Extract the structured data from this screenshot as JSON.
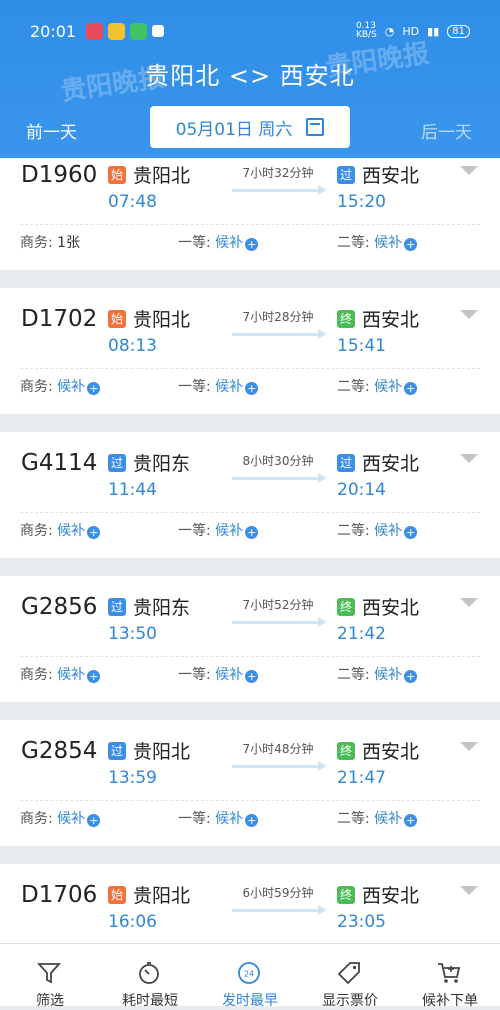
{
  "status_bar": {
    "time": "20:01",
    "network_speed": "0.13\nKB/S",
    "hd_label": "HD",
    "battery": "81"
  },
  "header": {
    "title": "贵阳北 <> 西安北",
    "prev_day": "前一天",
    "next_day": "后一天",
    "date": "05月01日 周六"
  },
  "watermark": "贵阳晚报",
  "trains": [
    {
      "no": "D1960",
      "from_badge": "始",
      "from_badge_type": "start",
      "from": "贵阳北",
      "dep": "07:48",
      "duration": "7小时32分钟",
      "to_badge": "过",
      "to_badge_type": "pass",
      "to": "西安北",
      "arr": "15:20",
      "seats": [
        {
          "label": "商务:",
          "value": "1张",
          "plus": false
        },
        {
          "label": "一等:",
          "value": "候补",
          "plus": true
        },
        {
          "label": "二等:",
          "value": "候补",
          "plus": true
        }
      ]
    },
    {
      "no": "D1702",
      "from_badge": "始",
      "from_badge_type": "start",
      "from": "贵阳北",
      "dep": "08:13",
      "duration": "7小时28分钟",
      "to_badge": "终",
      "to_badge_type": "end",
      "to": "西安北",
      "arr": "15:41",
      "seats": [
        {
          "label": "商务:",
          "value": "候补",
          "plus": true
        },
        {
          "label": "一等:",
          "value": "候补",
          "plus": true
        },
        {
          "label": "二等:",
          "value": "候补",
          "plus": true
        }
      ]
    },
    {
      "no": "G4114",
      "from_badge": "过",
      "from_badge_type": "pass",
      "from": "贵阳东",
      "dep": "11:44",
      "duration": "8小时30分钟",
      "to_badge": "过",
      "to_badge_type": "pass",
      "to": "西安北",
      "arr": "20:14",
      "seats": [
        {
          "label": "商务:",
          "value": "候补",
          "plus": true
        },
        {
          "label": "一等:",
          "value": "候补",
          "plus": true
        },
        {
          "label": "二等:",
          "value": "候补",
          "plus": true
        }
      ]
    },
    {
      "no": "G2856",
      "from_badge": "过",
      "from_badge_type": "pass",
      "from": "贵阳东",
      "dep": "13:50",
      "duration": "7小时52分钟",
      "to_badge": "终",
      "to_badge_type": "end",
      "to": "西安北",
      "arr": "21:42",
      "seats": [
        {
          "label": "商务:",
          "value": "候补",
          "plus": true
        },
        {
          "label": "一等:",
          "value": "候补",
          "plus": true
        },
        {
          "label": "二等:",
          "value": "候补",
          "plus": true
        }
      ]
    },
    {
      "no": "G2854",
      "from_badge": "过",
      "from_badge_type": "pass",
      "from": "贵阳北",
      "dep": "13:59",
      "duration": "7小时48分钟",
      "to_badge": "终",
      "to_badge_type": "end",
      "to": "西安北",
      "arr": "21:47",
      "seats": [
        {
          "label": "商务:",
          "value": "候补",
          "plus": true
        },
        {
          "label": "一等:",
          "value": "候补",
          "plus": true
        },
        {
          "label": "二等:",
          "value": "候补",
          "plus": true
        }
      ]
    },
    {
      "no": "D1706",
      "from_badge": "始",
      "from_badge_type": "start",
      "from": "贵阳北",
      "dep": "16:06",
      "duration": "6小时59分钟",
      "to_badge": "终",
      "to_badge_type": "end",
      "to": "西安北",
      "arr": "23:05",
      "seats": []
    }
  ],
  "bottom_tabs": [
    {
      "label": "筛选",
      "icon": "filter-icon",
      "active": false
    },
    {
      "label": "耗时最短",
      "icon": "stopwatch-icon",
      "active": false
    },
    {
      "label": "发时最早",
      "icon": "clock-24-icon",
      "active": true
    },
    {
      "label": "显示票价",
      "icon": "price-tag-icon",
      "active": false
    },
    {
      "label": "候补下单",
      "icon": "cart-icon",
      "active": false
    }
  ],
  "colors": {
    "header": "#2f8ee8",
    "accent": "#2f86d8",
    "start_badge": "#f1733b",
    "end_badge": "#4dbb58",
    "pass_badge": "#3d8fe6"
  }
}
